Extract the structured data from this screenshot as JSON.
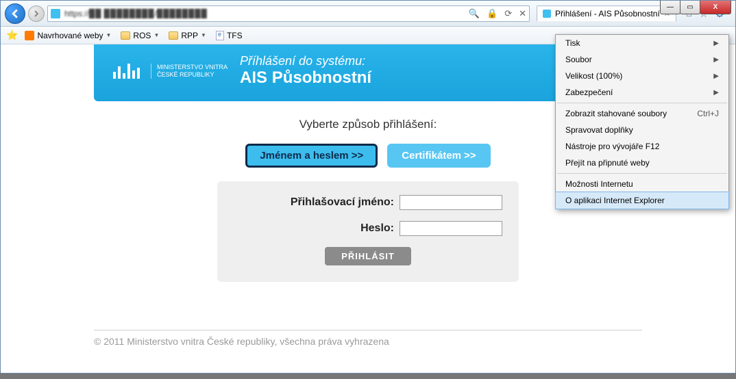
{
  "window": {
    "minimize": "—",
    "maximize": "▭",
    "close": "X"
  },
  "address": {
    "protocol": "https",
    "rest": "://▉▉ ▉▉▉▉▉▉▉▉/▉▉▉▉▉▉▉▉"
  },
  "tab": {
    "title": "Přihlášení - AIS Působnostní"
  },
  "favorites": {
    "suggested": "Navrhované weby",
    "ros": "ROS",
    "rpp": "RPP",
    "tfs": "TFS"
  },
  "banner": {
    "ministry_l1": "MINISTERSTVO VNITRA",
    "ministry_l2": "ČESKÉ REPUBLIKY",
    "title_l1": "Příhlášení do systému:",
    "title_l2": "AIS Působnostní"
  },
  "login": {
    "prompt": "Vyberte způsob přihlášení:",
    "btn_userpass": "Jménem a heslem >>",
    "btn_cert": "Certifikátem >>",
    "label_user": "Přihlašovací jméno:",
    "label_pass": "Heslo:",
    "submit": "PŘIHLÁSIT"
  },
  "footer": {
    "text": "© 2011 Ministerstvo vnitra České republiky, všechna práva vyhrazena"
  },
  "menu": {
    "print": "Tisk",
    "file": "Soubor",
    "zoom": "Velikost (100%)",
    "security": "Zabezpečení",
    "downloads": "Zobrazit stahované soubory",
    "downloads_sc": "Ctrl+J",
    "addons": "Spravovat doplňky",
    "devtools": "Nástroje pro vývojáře F12",
    "pinned": "Přejít na připnuté weby",
    "options": "Možnosti Internetu",
    "about": "O aplikaci Internet Explorer"
  }
}
